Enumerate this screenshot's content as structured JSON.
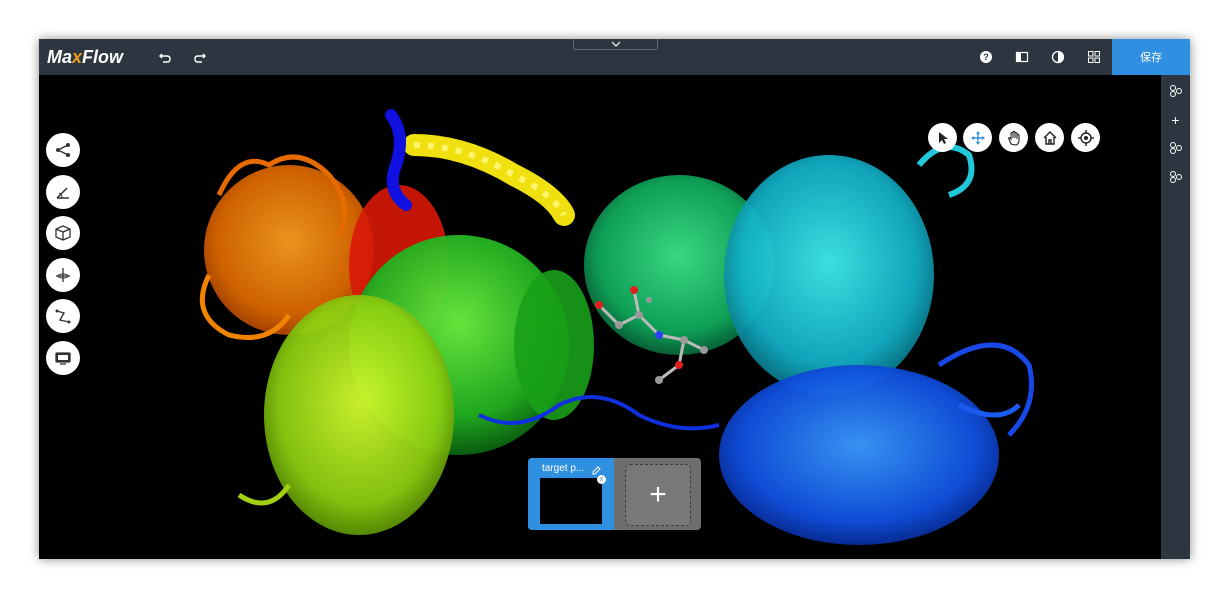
{
  "app": {
    "logo_prefix": "Ma",
    "logo_x": "x",
    "logo_suffix": "Flow"
  },
  "toolbar": {
    "undo_icon": "undo-icon",
    "redo_icon": "redo-icon",
    "help_label": "?",
    "save_label": "保存",
    "colors": {
      "bar": "#2d3640",
      "save": "#2f8fe0",
      "logo_accent": "#f29a1c"
    }
  },
  "left_tools": [
    "network-tool",
    "measure-tool",
    "box-tool",
    "axis-tool",
    "path-tool",
    "screen-tool"
  ],
  "nav_controls": [
    "select-cursor",
    "move",
    "pan-hand",
    "home",
    "center-target"
  ],
  "right_rail": [
    "node-tool",
    "add",
    "node-tool",
    "node-tool"
  ],
  "right_rail_add_label": "+",
  "snapshot": {
    "title": "target p...",
    "close_label": "x",
    "add_label": "+"
  }
}
